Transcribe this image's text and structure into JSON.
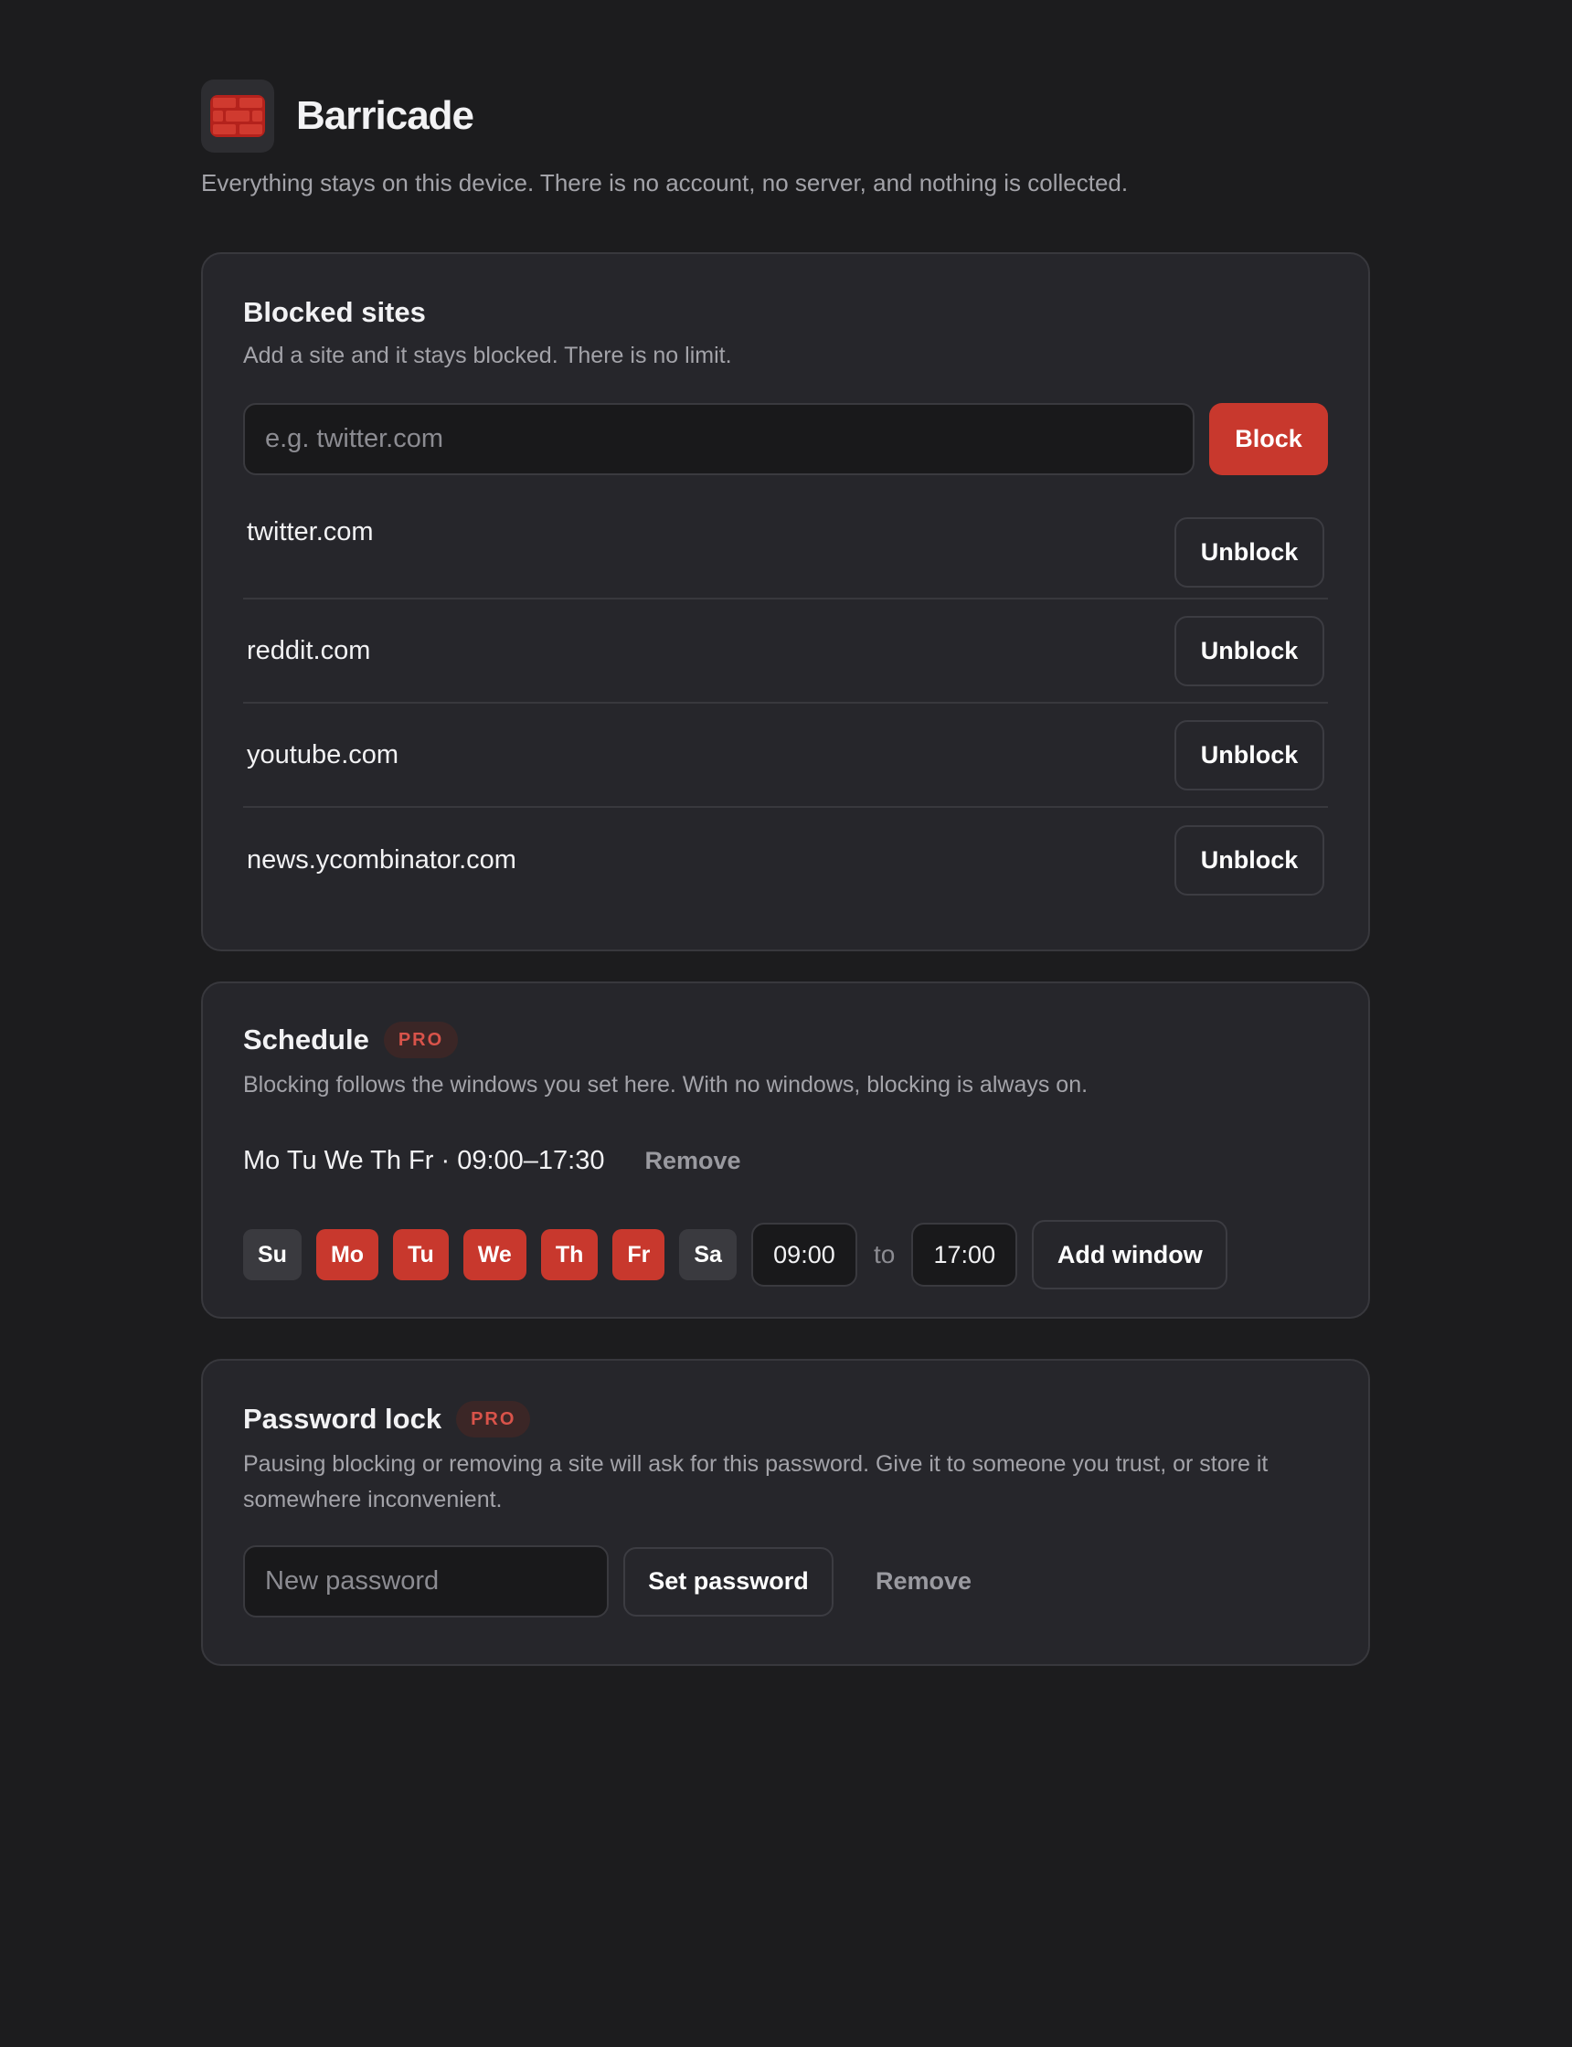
{
  "app": {
    "title": "Barricade",
    "tagline": "Everything stays on this device. There is no account, no server, and nothing is collected."
  },
  "blocked_sites": {
    "title": "Blocked sites",
    "description": "Add a site and it stays blocked. There is no limit.",
    "input_placeholder": "e.g. twitter.com",
    "block_label": "Block",
    "unblock_label": "Unblock",
    "sites": [
      "twitter.com",
      "reddit.com",
      "youtube.com",
      "news.ycombinator.com"
    ]
  },
  "schedule": {
    "title": "Schedule",
    "badge": "PRO",
    "description": "Blocking follows the windows you set here. With no windows, blocking is always on.",
    "windows": [
      {
        "text": "Mo Tu We Th Fr · 09:00–17:30",
        "remove_label": "Remove"
      }
    ],
    "days": [
      {
        "label": "Su",
        "selected": false
      },
      {
        "label": "Mo",
        "selected": true
      },
      {
        "label": "Tu",
        "selected": true
      },
      {
        "label": "We",
        "selected": true
      },
      {
        "label": "Th",
        "selected": true
      },
      {
        "label": "Fr",
        "selected": true
      },
      {
        "label": "Sa",
        "selected": false
      }
    ],
    "start_time": "09:00",
    "to_label": "to",
    "end_time": "17:00",
    "add_window_label": "Add window"
  },
  "password_lock": {
    "title": "Password lock",
    "badge": "PRO",
    "description": "Pausing blocking or removing a site will ask for this password. Give it to someone you trust, or store it somewhere inconvenient.",
    "input_placeholder": "New password",
    "set_label": "Set password",
    "remove_label": "Remove"
  },
  "colors": {
    "background": "#1c1c1e",
    "card": "#26262b",
    "accent": "#c8382d",
    "muted_text": "#a3a3a9"
  },
  "icons": {
    "logo": "brick-wall-icon"
  }
}
